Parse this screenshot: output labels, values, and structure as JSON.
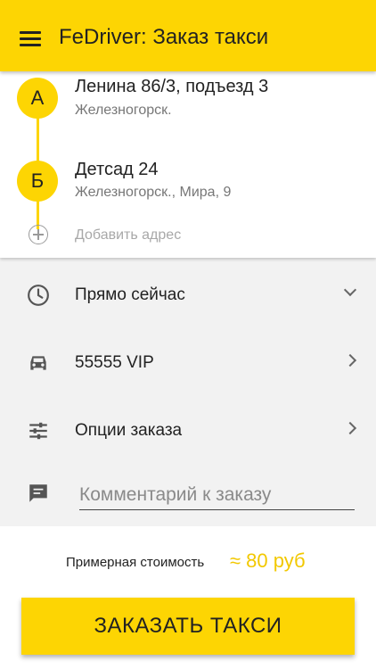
{
  "appbar": {
    "title": "FeDriver: Заказ такси"
  },
  "route": {
    "points": [
      {
        "marker": "А",
        "address": "Ленина 86/3, подъезд 3",
        "city": "Железногорск."
      },
      {
        "marker": "Б",
        "address": "Детсад 24",
        "city": "Железногорск., Мира, 9"
      }
    ],
    "add_label": "Добавить адрес"
  },
  "options": {
    "time_label": "Прямо сейчас",
    "tariff_label": "55555 VIP",
    "order_options_label": "Опции заказа",
    "comment_placeholder": "Комментарий к заказу"
  },
  "estimate": {
    "label": "Примерная стоимость",
    "value": "≈ 80 руб"
  },
  "order_button": {
    "label": "ЗАКАЗАТЬ ТАКСИ"
  },
  "colors": {
    "accent": "#fdd503",
    "price": "#f2c800"
  },
  "icons": [
    "menu-icon",
    "clock-icon",
    "car-icon",
    "sliders-icon",
    "comment-icon",
    "add-circle-icon",
    "chevron-down-icon",
    "chevron-right-icon"
  ]
}
